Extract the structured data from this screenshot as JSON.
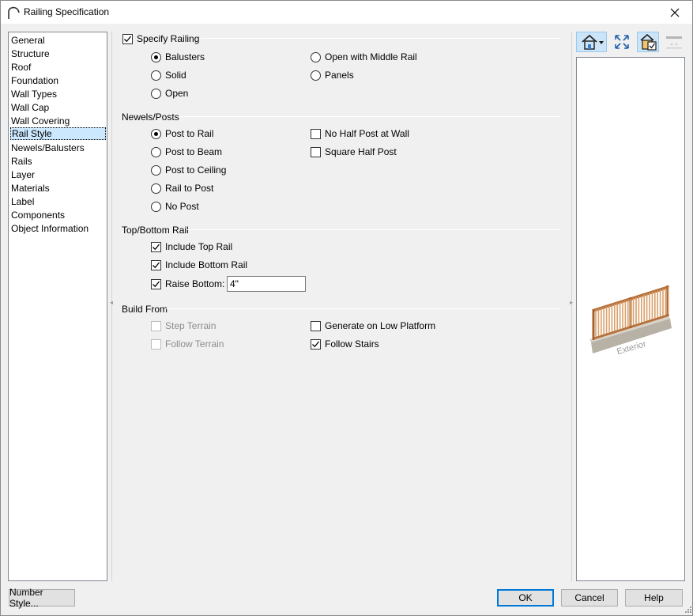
{
  "window": {
    "title": "Railing Specification"
  },
  "categories": [
    "General",
    "Structure",
    "Roof",
    "Foundation",
    "Wall Types",
    "Wall Cap",
    "Wall Covering",
    "Rail Style",
    "Newels/Balusters",
    "Rails",
    "Layer",
    "Materials",
    "Label",
    "Components",
    "Object Information"
  ],
  "selected_category": "Rail Style",
  "specify_railing": {
    "label": "Specify Railing",
    "checked": true
  },
  "rail_type": {
    "options": [
      "Balusters",
      "Solid",
      "Open",
      "Open with Middle Rail",
      "Panels"
    ],
    "selected": "Balusters"
  },
  "newels_posts": {
    "heading": "Newels/Posts",
    "options": [
      "Post to Rail",
      "Post to Beam",
      "Post to Ceiling",
      "Rail to Post",
      "No Post"
    ],
    "selected": "Post to Rail",
    "no_half_post": {
      "label": "No Half Post at Wall",
      "checked": false
    },
    "square_half_post": {
      "label": "Square Half Post",
      "checked": false
    }
  },
  "top_bottom_rail": {
    "heading": "Top/Bottom Rail",
    "include_top_rail": {
      "label": "Include Top Rail",
      "checked": true
    },
    "include_bottom_rail": {
      "label": "Include Bottom Rail",
      "checked": true
    },
    "raise_bottom": {
      "label": "Raise Bottom:",
      "checked": true,
      "value": "4\""
    }
  },
  "build_from": {
    "heading": "Build From",
    "step_terrain": {
      "label": "Step Terrain",
      "checked": false,
      "enabled": false
    },
    "follow_terrain": {
      "label": "Follow Terrain",
      "checked": false,
      "enabled": false
    },
    "generate_low_platform": {
      "label": "Generate on Low Platform",
      "checked": false,
      "enabled": true
    },
    "follow_stairs": {
      "label": "Follow Stairs",
      "checked": true,
      "enabled": true
    }
  },
  "preview": {
    "label": "Exterior"
  },
  "buttons": {
    "number_style": "Number Style...",
    "ok": "OK",
    "cancel": "Cancel",
    "help": "Help"
  },
  "colors": {
    "accent": "#0078d7",
    "selection": "#cce8ff",
    "railing_wood": "#c98a55"
  }
}
